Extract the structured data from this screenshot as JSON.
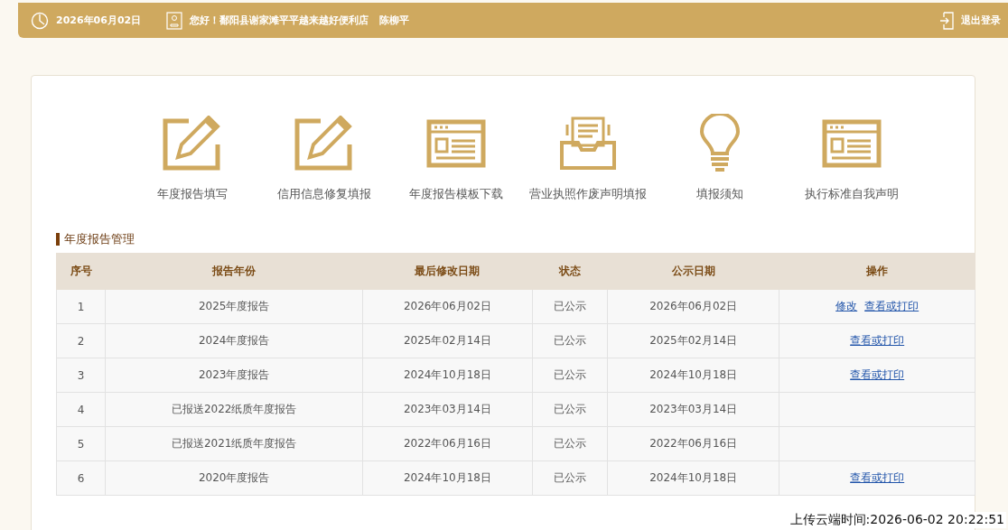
{
  "top_bar": {
    "date": "2026年06月02日",
    "greeting": "您好！鄱阳县谢家滩平平越来越好便利店",
    "user": "陈柳平",
    "logout": "退出登录"
  },
  "shortcuts": [
    {
      "kind": "edit",
      "label": "年度报告填写"
    },
    {
      "kind": "edit",
      "label": "信用信息修复填报"
    },
    {
      "kind": "form",
      "label": "年度报告模板下载"
    },
    {
      "kind": "tray",
      "label": "营业执照作废声明填报"
    },
    {
      "kind": "bulb",
      "label": "填报须知"
    },
    {
      "kind": "form",
      "label": "执行标准自我声明"
    }
  ],
  "section_title": "年度报告管理",
  "table": {
    "columns": [
      "序号",
      "报告年份",
      "最后修改日期",
      "状态",
      "公示日期",
      "操作"
    ],
    "rows": [
      {
        "cells": [
          "1",
          "2025年度报告",
          "2026年06月02日",
          "已公示",
          "2026年06月02日"
        ],
        "actions": [
          "修改",
          "查看或打印"
        ]
      },
      {
        "cells": [
          "2",
          "2024年度报告",
          "2025年02月14日",
          "已公示",
          "2025年02月14日"
        ],
        "actions": [
          "查看或打印"
        ]
      },
      {
        "cells": [
          "3",
          "2023年度报告",
          "2024年10月18日",
          "已公示",
          "2024年10月18日"
        ],
        "actions": [
          "查看或打印"
        ]
      },
      {
        "cells": [
          "4",
          "已报送2022纸质年度报告",
          "2023年03月14日",
          "已公示",
          "2023年03月14日"
        ],
        "actions": []
      },
      {
        "cells": [
          "5",
          "已报送2021纸质年度报告",
          "2022年06月16日",
          "已公示",
          "2022年06月16日"
        ],
        "actions": []
      },
      {
        "cells": [
          "6",
          "2020年度报告",
          "2024年10月18日",
          "已公示",
          "2024年10月18日"
        ],
        "actions": [
          "查看或打印"
        ]
      }
    ]
  },
  "upload_time": "上传云端时间:2026-06-02 20:22:51"
}
